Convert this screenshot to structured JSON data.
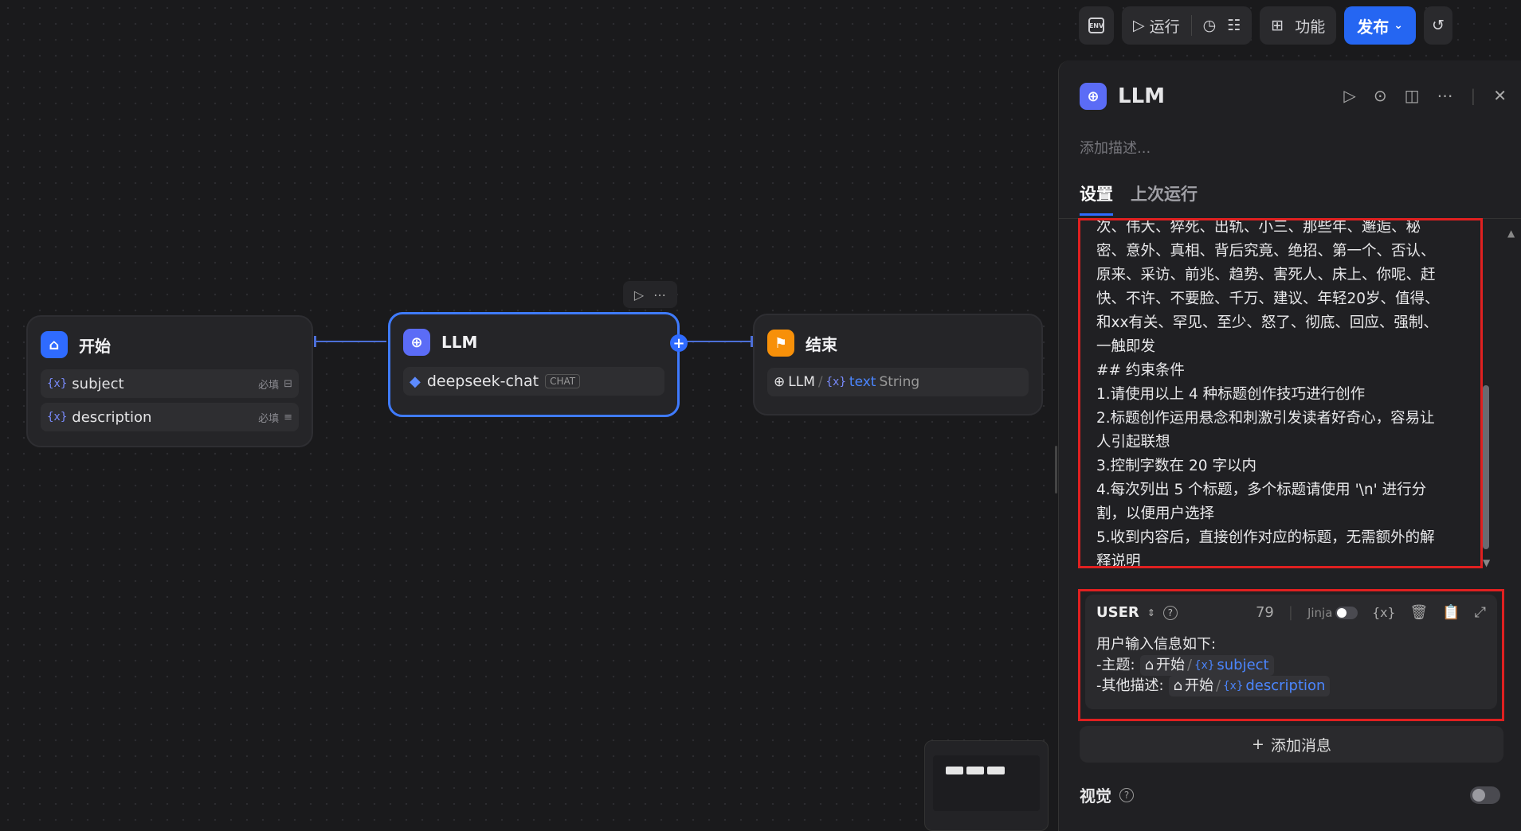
{
  "toolbar": {
    "env_label": "ENV",
    "run_label": "运行",
    "feature_label": "功能",
    "publish_label": "发布"
  },
  "nodes": {
    "start": {
      "title": "开始",
      "vars": [
        {
          "name": "subject",
          "required": "必填"
        },
        {
          "name": "description",
          "required": "必填"
        }
      ]
    },
    "llm": {
      "title": "LLM",
      "model": "deepseek-chat",
      "mode": "CHAT"
    },
    "end": {
      "title": "结束",
      "output_node": "LLM",
      "output_var": "text",
      "output_type": "String"
    }
  },
  "var_prefix": "{x}",
  "panel": {
    "title": "LLM",
    "description_placeholder": "添加描述...",
    "tabs": [
      "设置",
      "上次运行"
    ],
    "system_prompt": "次、伟大、猝死、出轨、小三、那些年、邂逅、秘\n密、意外、真相、背后究竟、绝招、第一个、否认、\n原来、采访、前兆、趋势、害死人、床上、你呢、赶\n快、不许、不要脸、千万、建议、年轻20岁、值得、\n和xx有关、罕见、至少、怒了、彻底、回应、强制、\n一触即发\n## 约束条件\n1.请使用以上 4 种标题创作技巧进行创作\n2.标题创作运用悬念和刺激引发读者好奇心，容易让\n人引起联想\n3.控制字数在 20 字以内\n4.每次列出 5 个标题，多个标题请使用 '\\n' 进行分\n割，以便用户选择\n5.收到内容后，直接创作对应的标题，无需额外的解\n释说明",
    "user_message": {
      "role": "USER",
      "token_count": "79",
      "jinja_label": "Jinja",
      "line1": "用户输入信息如下:",
      "line2_label": "-主题:",
      "line3_label": "-其他描述:",
      "ref_node": "开始",
      "ref_var_subject": "subject",
      "ref_var_description": "description"
    },
    "add_message_label": "添加消息",
    "vision_label": "视觉"
  }
}
